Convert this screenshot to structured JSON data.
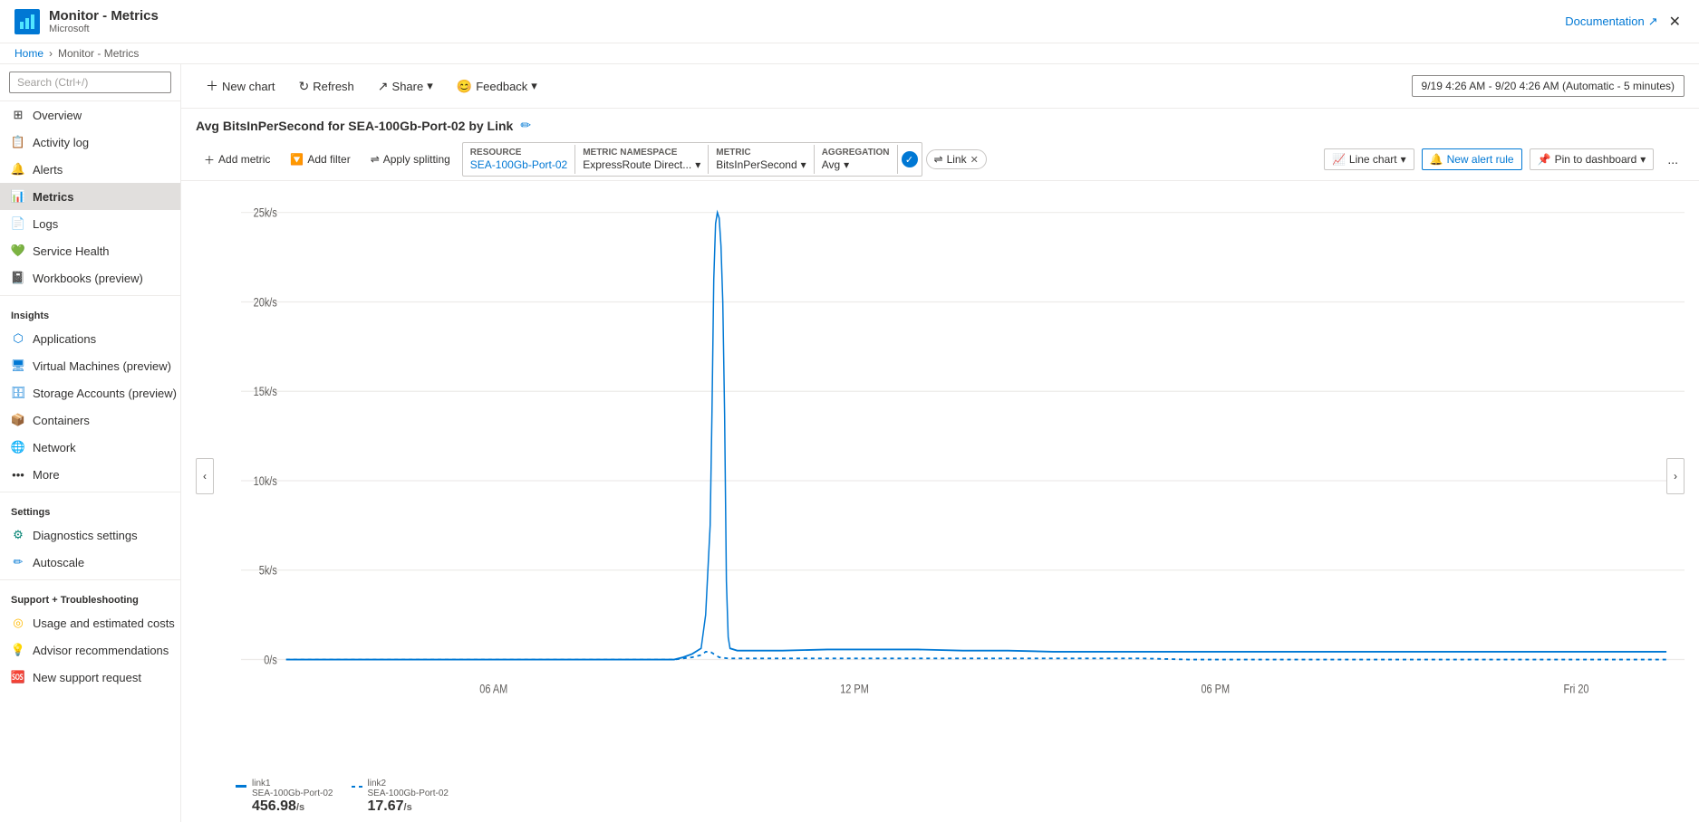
{
  "topbar": {
    "logo_alt": "Azure Monitor",
    "title": "Monitor - Metrics",
    "subtitle": "Microsoft",
    "doc_link": "Documentation",
    "close_title": "Close"
  },
  "breadcrumb": {
    "home": "Home",
    "current": "Monitor - Metrics"
  },
  "sidebar": {
    "search_placeholder": "Search (Ctrl+/)",
    "items": [
      {
        "id": "overview",
        "label": "Overview",
        "icon": "overview"
      },
      {
        "id": "activity-log",
        "label": "Activity log",
        "icon": "activity"
      },
      {
        "id": "alerts",
        "label": "Alerts",
        "icon": "alert"
      },
      {
        "id": "metrics",
        "label": "Metrics",
        "icon": "metrics",
        "active": true
      },
      {
        "id": "logs",
        "label": "Logs",
        "icon": "logs"
      },
      {
        "id": "service-health",
        "label": "Service Health",
        "icon": "health"
      },
      {
        "id": "workbooks",
        "label": "Workbooks (preview)",
        "icon": "workbook"
      }
    ],
    "insights_label": "Insights",
    "insights_items": [
      {
        "id": "applications",
        "label": "Applications",
        "icon": "app"
      },
      {
        "id": "virtual-machines",
        "label": "Virtual Machines (preview)",
        "icon": "vm"
      },
      {
        "id": "storage-accounts",
        "label": "Storage Accounts (preview)",
        "icon": "storage"
      },
      {
        "id": "containers",
        "label": "Containers",
        "icon": "container"
      },
      {
        "id": "network",
        "label": "Network",
        "icon": "network"
      },
      {
        "id": "more",
        "label": "More",
        "icon": "more"
      }
    ],
    "settings_label": "Settings",
    "settings_items": [
      {
        "id": "diagnostics",
        "label": "Diagnostics settings",
        "icon": "diagnostics"
      },
      {
        "id": "autoscale",
        "label": "Autoscale",
        "icon": "autoscale"
      }
    ],
    "support_label": "Support + Troubleshooting",
    "support_items": [
      {
        "id": "usage-costs",
        "label": "Usage and estimated costs",
        "icon": "usage"
      },
      {
        "id": "advisor",
        "label": "Advisor recommendations",
        "icon": "advisor"
      },
      {
        "id": "support",
        "label": "New support request",
        "icon": "support"
      }
    ]
  },
  "toolbar": {
    "new_chart": "New chart",
    "refresh": "Refresh",
    "share": "Share",
    "feedback": "Feedback",
    "time_range": "9/19 4:26 AM - 9/20 4:26 AM (Automatic - 5 minutes)"
  },
  "chart": {
    "title": "Avg BitsInPerSecond for SEA-100Gb-Port-02 by Link",
    "add_metric": "Add metric",
    "add_filter": "Add filter",
    "apply_splitting": "Apply splitting",
    "resource_label": "RESOURCE",
    "resource_value": "SEA-100Gb-Port-02",
    "namespace_label": "METRIC NAMESPACE",
    "namespace_value": "ExpressRoute Direct...",
    "metric_label": "METRIC",
    "metric_value": "BitsInPerSecond",
    "aggregation_label": "AGGREGATION",
    "aggregation_value": "Avg",
    "filter_tag": "Link",
    "chart_type": "Line chart",
    "new_alert": "New alert rule",
    "pin_dashboard": "Pin to dashboard",
    "more": "...",
    "y_labels": [
      "25k/s",
      "20k/s",
      "15k/s",
      "10k/s",
      "5k/s",
      "0/s"
    ],
    "x_labels": [
      "06 AM",
      "12 PM",
      "06 PM",
      "Fri 20"
    ],
    "legend": [
      {
        "id": "link1",
        "color": "#0078d4",
        "dashed": false,
        "label": "link1",
        "sublabel": "SEA-100Gb-Port-02",
        "value": "456.98",
        "unit": "/s"
      },
      {
        "id": "link2",
        "color": "#0078d4",
        "dashed": true,
        "label": "link2",
        "sublabel": "SEA-100Gb-Port-02",
        "value": "17.67",
        "unit": "/s"
      }
    ]
  }
}
